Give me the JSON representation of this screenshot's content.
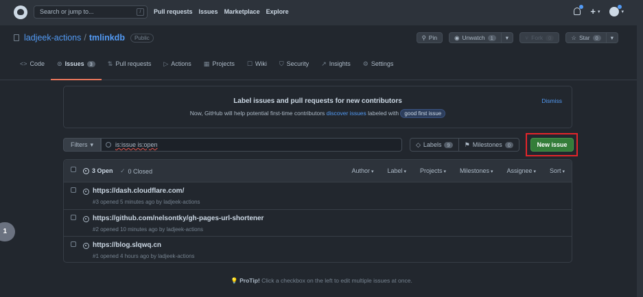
{
  "topbar": {
    "search_placeholder": "Search or jump to...",
    "search_shortcut": "/",
    "nav": [
      "Pull requests",
      "Issues",
      "Marketplace",
      "Explore"
    ]
  },
  "repo": {
    "owner": "ladjeek-actions",
    "separator": "/",
    "name": "tmlinkdb",
    "visibility": "Public",
    "pin_label": "Pin",
    "unwatch_label": "Unwatch",
    "unwatch_count": "1",
    "fork_label": "Fork",
    "fork_count": "0",
    "star_label": "Star",
    "star_count": "0"
  },
  "tabs": [
    {
      "icon": "<>",
      "label": "Code"
    },
    {
      "icon": "⊙",
      "label": "Issues",
      "count": "3"
    },
    {
      "icon": "⇅",
      "label": "Pull requests"
    },
    {
      "icon": "▷",
      "label": "Actions"
    },
    {
      "icon": "▦",
      "label": "Projects"
    },
    {
      "icon": "☐",
      "label": "Wiki"
    },
    {
      "icon": "⛉",
      "label": "Security"
    },
    {
      "icon": "↗",
      "label": "Insights"
    },
    {
      "icon": "⚙",
      "label": "Settings"
    }
  ],
  "banner": {
    "title": "Label issues and pull requests for new contributors",
    "text_before": "Now, GitHub will help potential first-time contributors",
    "link": "discover issues",
    "text_after": "labeled with",
    "label": "good first issue",
    "dismiss": "Dismiss"
  },
  "filterbar": {
    "filters_label": "Filters",
    "query": "is:issue is:open",
    "labels_label": "Labels",
    "labels_count": "9",
    "milestones_label": "Milestones",
    "milestones_count": "0",
    "new_issue_label": "New issue"
  },
  "list": {
    "open_label": "3 Open",
    "closed_label": "0 Closed",
    "sorts": [
      "Author",
      "Label",
      "Projects",
      "Milestones",
      "Assignee",
      "Sort"
    ],
    "issues": [
      {
        "title": "https://dash.cloudflare.com/",
        "meta": "#3 opened 5 minutes ago by ladjeek-actions"
      },
      {
        "title": "https://github.com/nelsontky/gh-pages-url-shortener",
        "meta": "#2 opened 10 minutes ago by ladjeek-actions"
      },
      {
        "title": "https://blog.slqwq.cn",
        "meta": "#1 opened 4 hours ago by ladjeek-actions"
      }
    ]
  },
  "protip": {
    "strong": "ProTip!",
    "text": "Click a checkbox on the left to edit multiple issues at once."
  },
  "side_badge": "1"
}
